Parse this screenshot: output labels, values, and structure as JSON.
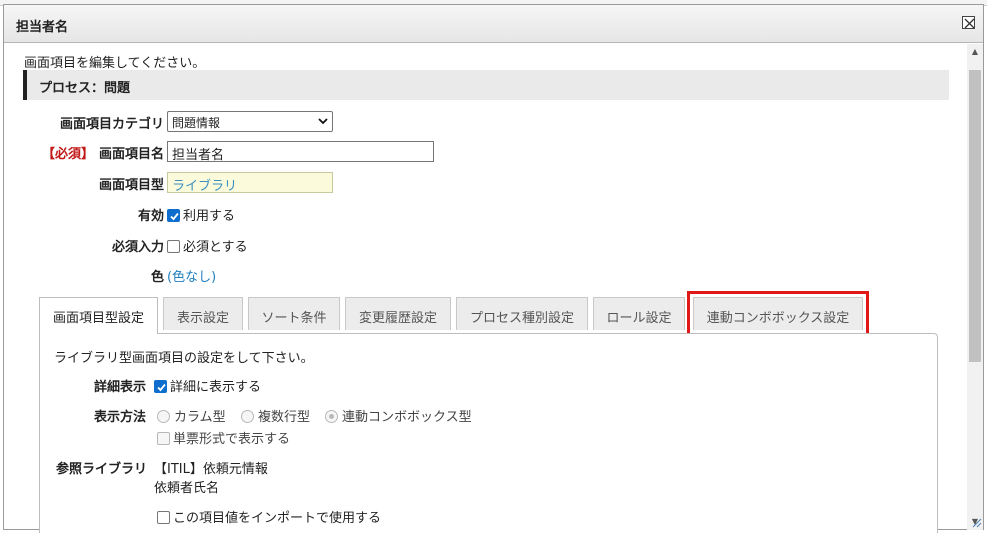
{
  "dialog": {
    "title": "担当者名"
  },
  "instruction": "画面項目を編集してください。",
  "section": {
    "heading": "プロセス：問題"
  },
  "form": {
    "category": {
      "label": "画面項目カテゴリ",
      "value": "問題情報"
    },
    "name": {
      "required_mark": "【必須】",
      "label": "画面項目名",
      "value": "担当者名"
    },
    "type": {
      "label": "画面項目型",
      "value": "ライブラリ"
    },
    "enabled": {
      "label": "有効",
      "checkbox_label": "利用する",
      "checked": true
    },
    "required": {
      "label": "必須入力",
      "checkbox_label": "必須とする",
      "checked": false
    },
    "color": {
      "label": "色",
      "value": "(色なし)"
    }
  },
  "tabs": [
    {
      "label": "画面項目型設定",
      "active": true
    },
    {
      "label": "表示設定",
      "active": false
    },
    {
      "label": "ソート条件",
      "active": false
    },
    {
      "label": "変更履歴設定",
      "active": false
    },
    {
      "label": "プロセス種別設定",
      "active": false
    },
    {
      "label": "ロール設定",
      "active": false
    },
    {
      "label": "連動コンボボックス設定",
      "active": false,
      "highlighted": true
    }
  ],
  "panel": {
    "intro": "ライブラリ型画面項目の設定をして下さい。",
    "detail": {
      "label": "詳細表示",
      "checkbox_label": "詳細に表示する",
      "checked": true
    },
    "display_method": {
      "label": "表示方法",
      "options": [
        "カラム型",
        "複数行型",
        "連動コンボボックス型"
      ],
      "selected": "連動コンボボックス型",
      "single_form_label": "単票形式で表示する"
    },
    "ref_library": {
      "label": "参照ライブラリ",
      "value": "【ITIL】依頼元情報",
      "field": "依頼者氏名"
    },
    "import_label": "この項目値をインポートで使用する"
  },
  "colors": {
    "accent_blue": "#0f6ecd",
    "link": "#1f7fbf",
    "required_red": "#c21818",
    "highlight_red": "#e01818"
  }
}
